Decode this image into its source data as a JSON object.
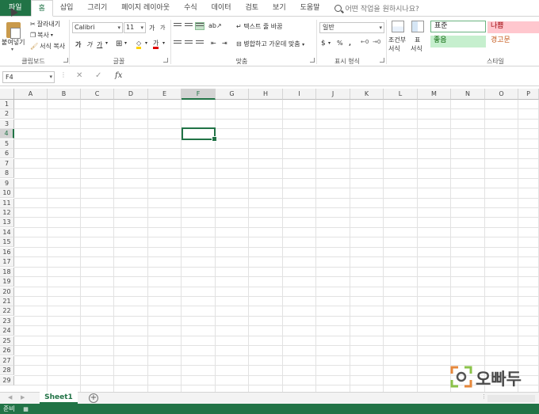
{
  "tabs": [
    {
      "label": "파일"
    },
    {
      "label": "홈"
    },
    {
      "label": "삽입"
    },
    {
      "label": "그리기"
    },
    {
      "label": "페이지 레이아웃"
    },
    {
      "label": "수식"
    },
    {
      "label": "데이터"
    },
    {
      "label": "검토"
    },
    {
      "label": "보기"
    },
    {
      "label": "도움말"
    }
  ],
  "tell_me": "어떤 작업을 원하시나요?",
  "clipboard": {
    "paste": "붙여넣기",
    "cut": "잘라내기",
    "copy": "복사",
    "format_painter": "서식 복사",
    "label": "클립보드"
  },
  "font": {
    "name": "Calibri",
    "size": "11",
    "grow": "가",
    "shrink": "가",
    "bold": "가",
    "italic": "가",
    "underline": "가",
    "color_letter": "가",
    "label": "글꼴"
  },
  "alignment": {
    "wrap_text": "텍스트 줄 바꿈",
    "merge_center": "병합하고 가운데 맞춤",
    "label": "맞춤"
  },
  "number": {
    "format": "일반",
    "currency": "$",
    "percent": "%",
    "comma": ",",
    "label": "표시 형식"
  },
  "styles": {
    "conditional_top": "조건부",
    "conditional_bottom": "서식",
    "table_top": "표",
    "table_bottom": "서식",
    "normal": "표준",
    "bad": "나쁨",
    "good": "좋음",
    "neutral": "경고문",
    "label": "스타일"
  },
  "formula_bar": {
    "name_box": "F4",
    "fx": "fx",
    "cancel": "✕",
    "enter": "✓"
  },
  "columns": [
    "A",
    "B",
    "C",
    "D",
    "E",
    "F",
    "G",
    "H",
    "I",
    "J",
    "K",
    "L",
    "M",
    "N",
    "O",
    "P"
  ],
  "rows": [
    "1",
    "2",
    "3",
    "4",
    "5",
    "6",
    "7",
    "8",
    "9",
    "10",
    "11",
    "12",
    "13",
    "14",
    "15",
    "16",
    "17",
    "18",
    "19",
    "20",
    "21",
    "22",
    "23",
    "24",
    "25",
    "26",
    "27",
    "28",
    "29"
  ],
  "selected": {
    "column": "F",
    "row": "4"
  },
  "sheet_tab": "Sheet1",
  "add_sheet": "+",
  "status": "준비",
  "watermark": "오빠두"
}
